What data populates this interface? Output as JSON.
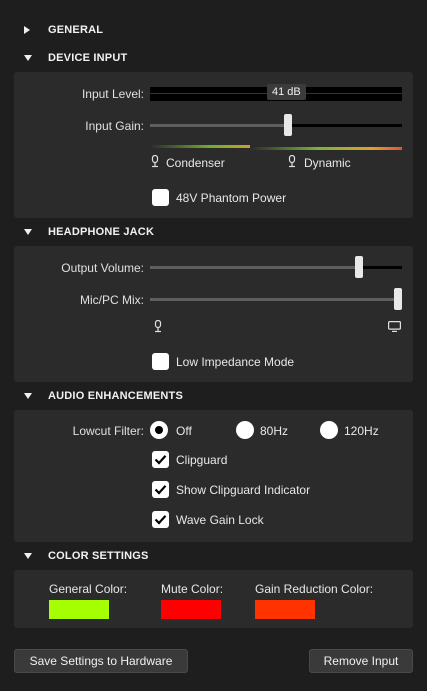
{
  "sections": {
    "general": {
      "title": "GENERAL",
      "expanded": false
    },
    "device_input": {
      "title": "DEVICE INPUT",
      "input_level_label": "Input Level:",
      "input_level_tooltip": "41 dB",
      "input_gain_label": "Input Gain:",
      "input_gain_value": 0.53,
      "mic_type_condenser": "Condenser",
      "mic_type_dynamic": "Dynamic",
      "phantom_power_label": "48V Phantom Power",
      "phantom_power_checked": false
    },
    "headphone_jack": {
      "title": "HEADPHONE JACK",
      "output_volume_label": "Output Volume:",
      "output_volume_value": 0.83,
      "mic_pc_mix_label": "Mic/PC Mix:",
      "mic_pc_mix_value": 1.0,
      "low_impedance_label": "Low Impedance Mode",
      "low_impedance_checked": false
    },
    "audio_enhancements": {
      "title": "AUDIO ENHANCEMENTS",
      "lowcut_label": "Lowcut Filter:",
      "lowcut_options": [
        "Off",
        "80Hz",
        "120Hz"
      ],
      "lowcut_selected": "Off",
      "clipguard_label": "Clipguard",
      "show_clipguard_indicator_label": "Show Clipguard Indicator",
      "wave_gain_lock_label": "Wave Gain Lock"
    },
    "color_settings": {
      "title": "COLOR SETTINGS",
      "general_color_label": "General Color:",
      "general_color": "#a6ff00",
      "mute_color_label": "Mute Color:",
      "mute_color": "#ff0000",
      "gain_reduction_color_label": "Gain Reduction Color:",
      "gain_reduction_color": "#ff3300"
    }
  },
  "footer": {
    "save_button": "Save Settings to Hardware",
    "remove_button": "Remove Input"
  },
  "icons": {
    "expand": "triangle-right-icon",
    "collapse": "triangle-down-icon",
    "mic": "microphone-icon",
    "pc": "monitor-icon"
  }
}
